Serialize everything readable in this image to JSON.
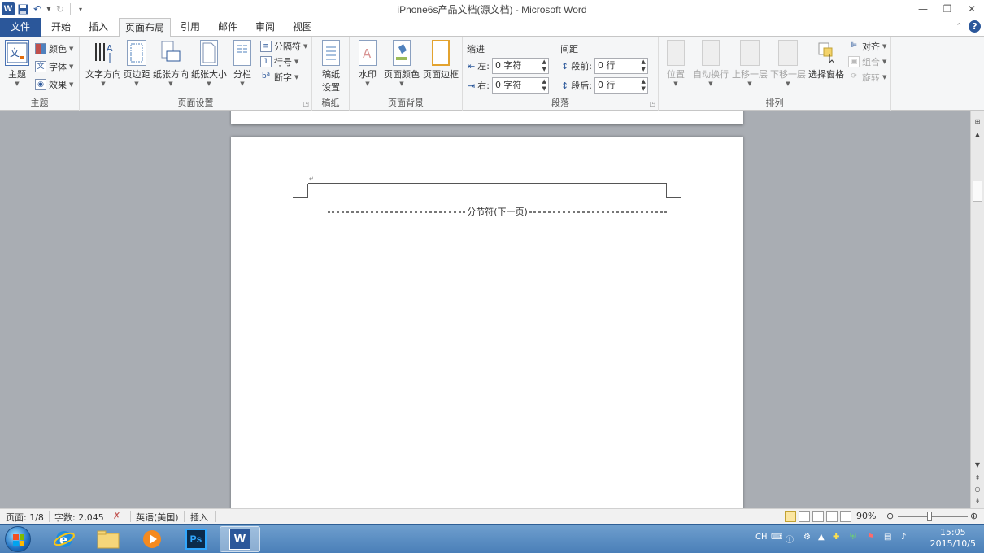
{
  "window": {
    "title": "iPhone6s产品文档(源文档)  -  Microsoft Word",
    "controls": [
      "minimize",
      "restore",
      "close"
    ]
  },
  "tabs": [
    {
      "label": "文件",
      "kind": "file"
    },
    {
      "label": "开始"
    },
    {
      "label": "插入"
    },
    {
      "label": "页面布局",
      "active": true
    },
    {
      "label": "引用"
    },
    {
      "label": "邮件"
    },
    {
      "label": "审阅"
    },
    {
      "label": "视图"
    }
  ],
  "ribbon": {
    "theme": {
      "label": "主题",
      "theme_button": "主题",
      "colors": "颜色",
      "fonts": "字体",
      "effects": "效果"
    },
    "page_setup": {
      "label": "页面设置",
      "text_direction": "文字方向",
      "margins": "页边距",
      "orientation": "纸张方向",
      "size": "纸张大小",
      "columns": "分栏",
      "breaks": "分隔符",
      "line_numbers": "行号",
      "hyphenation": "断字"
    },
    "manuscript": {
      "label": "稿纸",
      "settings_line1": "稿纸",
      "settings_line2": "设置"
    },
    "page_background": {
      "label": "页面背景",
      "watermark": "水印",
      "page_color": "页面颜色",
      "page_borders": "页面边框"
    },
    "paragraph": {
      "label": "段落",
      "indent_title": "缩进",
      "spacing_title": "间距",
      "left_label": "左:",
      "left_value": "0 字符",
      "right_label": "右:",
      "right_value": "0 字符",
      "before_label": "段前:",
      "before_value": "0 行",
      "after_label": "段后:",
      "after_value": "0 行"
    },
    "arrange": {
      "label": "排列",
      "position": "位置",
      "wrap_text": "自动换行",
      "bring_forward": "上移一层",
      "send_backward": "下移一层",
      "selection_pane": "选择窗格",
      "align": "对齐",
      "group": "组合",
      "rotate": "旋转"
    }
  },
  "document": {
    "section_break": "分节符(下一页)"
  },
  "status": {
    "page": "页面: 1/8",
    "words": "字数: 2,045",
    "language": "英语(美国)",
    "mode": "插入",
    "zoom": "90%"
  },
  "taskbar": {
    "apps": [
      "internet-explorer",
      "file-explorer",
      "media-player",
      "photoshop",
      "word"
    ],
    "ime": "CH",
    "time": "15:05",
    "date": "2015/10/5"
  },
  "colors": {
    "accent": "#2b579a",
    "ribbon_bg": "#f5f6f7",
    "doc_bg": "#a9adb3"
  }
}
